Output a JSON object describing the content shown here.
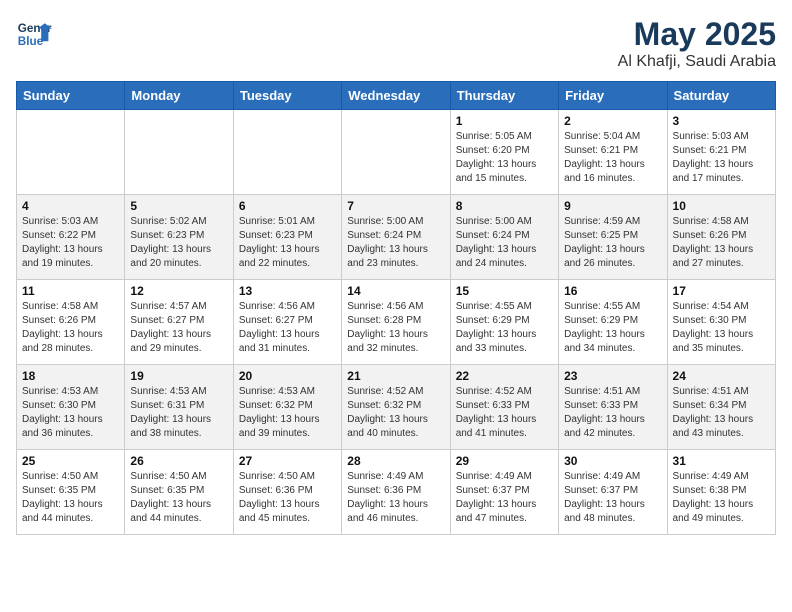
{
  "header": {
    "logo_line1": "General",
    "logo_line2": "Blue",
    "month": "May 2025",
    "location": "Al Khafji, Saudi Arabia"
  },
  "weekdays": [
    "Sunday",
    "Monday",
    "Tuesday",
    "Wednesday",
    "Thursday",
    "Friday",
    "Saturday"
  ],
  "weeks": [
    [
      {
        "day": "",
        "info": ""
      },
      {
        "day": "",
        "info": ""
      },
      {
        "day": "",
        "info": ""
      },
      {
        "day": "",
        "info": ""
      },
      {
        "day": "1",
        "info": "Sunrise: 5:05 AM\nSunset: 6:20 PM\nDaylight: 13 hours and 15 minutes."
      },
      {
        "day": "2",
        "info": "Sunrise: 5:04 AM\nSunset: 6:21 PM\nDaylight: 13 hours and 16 minutes."
      },
      {
        "day": "3",
        "info": "Sunrise: 5:03 AM\nSunset: 6:21 PM\nDaylight: 13 hours and 17 minutes."
      }
    ],
    [
      {
        "day": "4",
        "info": "Sunrise: 5:03 AM\nSunset: 6:22 PM\nDaylight: 13 hours and 19 minutes."
      },
      {
        "day": "5",
        "info": "Sunrise: 5:02 AM\nSunset: 6:23 PM\nDaylight: 13 hours and 20 minutes."
      },
      {
        "day": "6",
        "info": "Sunrise: 5:01 AM\nSunset: 6:23 PM\nDaylight: 13 hours and 22 minutes."
      },
      {
        "day": "7",
        "info": "Sunrise: 5:00 AM\nSunset: 6:24 PM\nDaylight: 13 hours and 23 minutes."
      },
      {
        "day": "8",
        "info": "Sunrise: 5:00 AM\nSunset: 6:24 PM\nDaylight: 13 hours and 24 minutes."
      },
      {
        "day": "9",
        "info": "Sunrise: 4:59 AM\nSunset: 6:25 PM\nDaylight: 13 hours and 26 minutes."
      },
      {
        "day": "10",
        "info": "Sunrise: 4:58 AM\nSunset: 6:26 PM\nDaylight: 13 hours and 27 minutes."
      }
    ],
    [
      {
        "day": "11",
        "info": "Sunrise: 4:58 AM\nSunset: 6:26 PM\nDaylight: 13 hours and 28 minutes."
      },
      {
        "day": "12",
        "info": "Sunrise: 4:57 AM\nSunset: 6:27 PM\nDaylight: 13 hours and 29 minutes."
      },
      {
        "day": "13",
        "info": "Sunrise: 4:56 AM\nSunset: 6:27 PM\nDaylight: 13 hours and 31 minutes."
      },
      {
        "day": "14",
        "info": "Sunrise: 4:56 AM\nSunset: 6:28 PM\nDaylight: 13 hours and 32 minutes."
      },
      {
        "day": "15",
        "info": "Sunrise: 4:55 AM\nSunset: 6:29 PM\nDaylight: 13 hours and 33 minutes."
      },
      {
        "day": "16",
        "info": "Sunrise: 4:55 AM\nSunset: 6:29 PM\nDaylight: 13 hours and 34 minutes."
      },
      {
        "day": "17",
        "info": "Sunrise: 4:54 AM\nSunset: 6:30 PM\nDaylight: 13 hours and 35 minutes."
      }
    ],
    [
      {
        "day": "18",
        "info": "Sunrise: 4:53 AM\nSunset: 6:30 PM\nDaylight: 13 hours and 36 minutes."
      },
      {
        "day": "19",
        "info": "Sunrise: 4:53 AM\nSunset: 6:31 PM\nDaylight: 13 hours and 38 minutes."
      },
      {
        "day": "20",
        "info": "Sunrise: 4:53 AM\nSunset: 6:32 PM\nDaylight: 13 hours and 39 minutes."
      },
      {
        "day": "21",
        "info": "Sunrise: 4:52 AM\nSunset: 6:32 PM\nDaylight: 13 hours and 40 minutes."
      },
      {
        "day": "22",
        "info": "Sunrise: 4:52 AM\nSunset: 6:33 PM\nDaylight: 13 hours and 41 minutes."
      },
      {
        "day": "23",
        "info": "Sunrise: 4:51 AM\nSunset: 6:33 PM\nDaylight: 13 hours and 42 minutes."
      },
      {
        "day": "24",
        "info": "Sunrise: 4:51 AM\nSunset: 6:34 PM\nDaylight: 13 hours and 43 minutes."
      }
    ],
    [
      {
        "day": "25",
        "info": "Sunrise: 4:50 AM\nSunset: 6:35 PM\nDaylight: 13 hours and 44 minutes."
      },
      {
        "day": "26",
        "info": "Sunrise: 4:50 AM\nSunset: 6:35 PM\nDaylight: 13 hours and 44 minutes."
      },
      {
        "day": "27",
        "info": "Sunrise: 4:50 AM\nSunset: 6:36 PM\nDaylight: 13 hours and 45 minutes."
      },
      {
        "day": "28",
        "info": "Sunrise: 4:49 AM\nSunset: 6:36 PM\nDaylight: 13 hours and 46 minutes."
      },
      {
        "day": "29",
        "info": "Sunrise: 4:49 AM\nSunset: 6:37 PM\nDaylight: 13 hours and 47 minutes."
      },
      {
        "day": "30",
        "info": "Sunrise: 4:49 AM\nSunset: 6:37 PM\nDaylight: 13 hours and 48 minutes."
      },
      {
        "day": "31",
        "info": "Sunrise: 4:49 AM\nSunset: 6:38 PM\nDaylight: 13 hours and 49 minutes."
      }
    ]
  ]
}
